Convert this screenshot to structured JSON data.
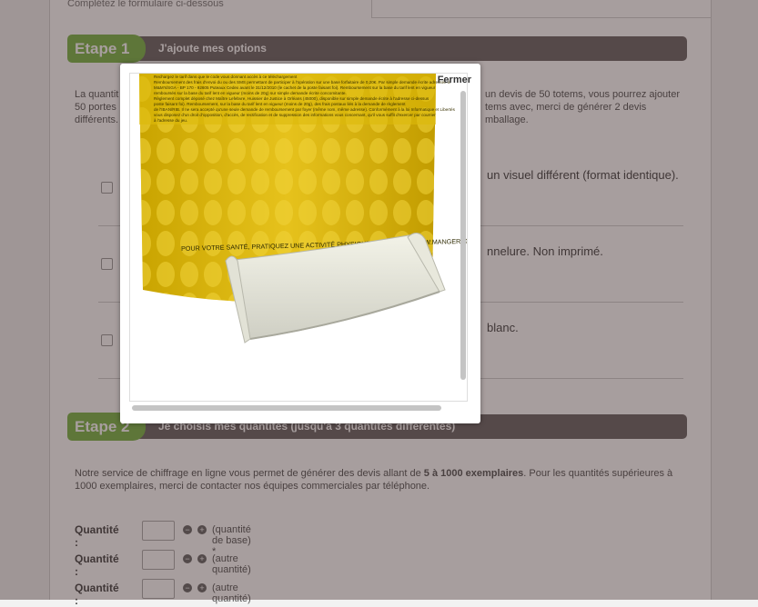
{
  "page": {
    "subtitle": "Complétez le formulaire ci-dessous"
  },
  "step1": {
    "badge": "Etape 1",
    "title": "J'ajoute mes options",
    "intro_left_1": "La quantit",
    "intro_left_2": "50 portes",
    "intro_left_3": "différents.",
    "intro_right_1": "un devis de 50 totems, vous pourrez ajouter",
    "intro_right_2": "tems avec, merci de générer 2 devis",
    "intro_right_3": "mballage.",
    "options": [
      {
        "text": "un visuel différent (format identique)."
      },
      {
        "text": "nnelure. Non imprimé."
      },
      {
        "text": "blanc."
      }
    ]
  },
  "step2": {
    "badge": "Etape 2",
    "title": "Je choisis mes quantités (jusqu'à 3 quantités différentes)",
    "intro_1a": "Notre service de chiffrage en ligne vous permet de générer des devis allant de ",
    "intro_1b": "5 à 1000 exemplaires",
    "intro_1c": ". Pour les quantités supérieures à",
    "intro_2": "1000 exemplaires, merci de contacter nos équipes commerciales par téléphone.",
    "quantities": [
      {
        "label": "Quantité :",
        "hint": "(quantité de base) *"
      },
      {
        "label": "Quantité :",
        "hint": "(autre quantité)"
      },
      {
        "label": "Quantité :",
        "hint": "(autre quantité)"
      }
    ],
    "minus_symbol": "−",
    "plus_symbol": "+"
  },
  "modal": {
    "close_label": "Fermer",
    "image_slogan": "POUR VOTRE SANTÉ, PRATIQUEZ UNE ACTIVITÉ PHYSIQUE RÉGULIÈRE  WWW.MANGERBOUGER.FR",
    "fine_print": [
      "Rechargez le tarif dans que le code vous donnant accès à ce téléchargement",
      "Remboursement des frais d'envoi du ou des SMS permettant de participer à l'opération sur une base forfaitaire de 0,20€. Par simple demande écrite adressée à",
      "M&M's/SGA - BP 170 - 92605 Puteaux Cedex avant le 31/12/2010 (le cachet de la poste faisant foi). Remboursement sur la base du tarif lent en vigueur",
      "remboursés sur la base du tarif lent en vigueur (moins de 20g) sur simple demande écrite concomitante.",
      "Règlement complet déposé chez Maître Lefebvre, Huissier de Justice à Orléans (45000), disponible sur simple demande écrite à l'adresse ci-dessus",
      "poste faisant foi). Remboursement, sur la base du tarif lent en vigueur (moins de 20g), des frais postaux liés à la demande de règlement",
      "de l'IBAN/RIB. Il ne sera accepté qu'une seule demande de remboursement par foyer (même nom, même adresse). Conformément à la loi Informatique et Libertés",
      "vous disposez d'un droit d'opposition, d'accès, de rectification et de suppression des informations vous concernant, qu'il vous suffit d'exercer par courrier",
      "à l'adresse du jeu."
    ]
  }
}
